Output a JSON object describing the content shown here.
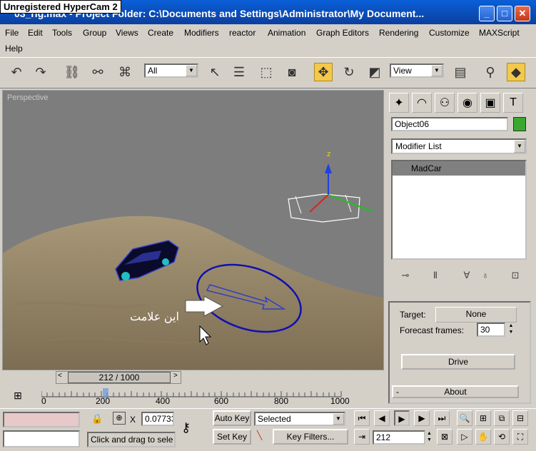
{
  "window": {
    "watermark": "Unregistered HyperCam 2",
    "title": "03_rig.max - Project Folder: C:\\Documents and Settings\\Administrator\\My Document...",
    "buttons": [
      "minimize",
      "maximize",
      "close"
    ]
  },
  "menu": [
    "File",
    "Edit",
    "Tools",
    "Group",
    "Views",
    "Create",
    "Modifiers",
    "reactor",
    "Animation",
    "Graph Editors",
    "Rendering",
    "Customize",
    "MAXScript",
    "Help"
  ],
  "toolbar": {
    "selection_filter": "All",
    "reference_coord": "View"
  },
  "viewport": {
    "label": "Perspective",
    "annotation": "این علامت",
    "gizmo_axis_label": "z"
  },
  "command_panel": {
    "object_name": "Object06",
    "object_color": "#3aa830",
    "modifier_list": "Modifier List",
    "stack_items": [
      "MadCar"
    ],
    "target_label": "Target:",
    "target_value": "None",
    "forecast_label": "Forecast frames:",
    "forecast_value": "30",
    "drive_button": "Drive",
    "about_rollout": "About",
    "about_toggle": "-"
  },
  "timeline": {
    "slider_text": "212 / 1000",
    "ticks": [
      "0",
      "200",
      "400",
      "600",
      "800",
      "1000"
    ],
    "current_frame": "212"
  },
  "status": {
    "x_label": "X",
    "x_value": "0.07733",
    "auto_key": "Auto Key",
    "set_key": "Set Key",
    "key_mode": "Selected",
    "key_filters": "Key Filters...",
    "prompt": "Click and drag to sele"
  }
}
